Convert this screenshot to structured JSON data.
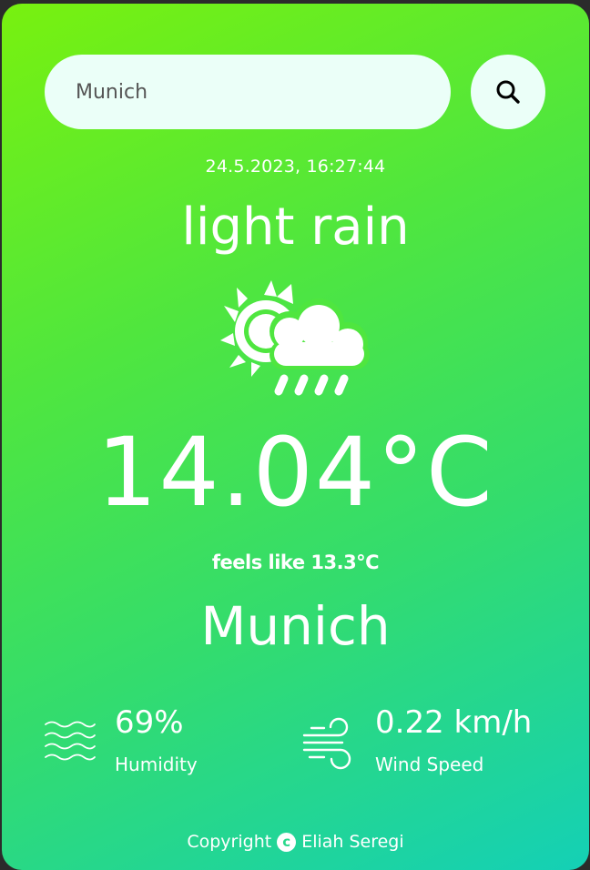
{
  "search": {
    "value": "Munich",
    "placeholder": ""
  },
  "icons": {
    "search": "search-icon",
    "weather": "partly-cloudy-rain-icon",
    "humidity": "humidity-waves-icon",
    "wind": "wind-icon",
    "copyright": "copyright-icon"
  },
  "weather": {
    "datetime": "24.5.2023, 16:27:44",
    "description": "light rain",
    "temperature": "14.04°C",
    "feels_like": "feels like 13.3°C",
    "city": "Munich"
  },
  "stats": {
    "humidity": {
      "value": "69%",
      "label": "Humidity"
    },
    "wind": {
      "value": "0.22 km/h",
      "label": "Wind Speed"
    }
  },
  "footer": {
    "copyright_label": "Copyright",
    "copyright_symbol": "c",
    "author": "Eliah Seregi"
  },
  "colors": {
    "gradient_start": "#78f10f",
    "gradient_end": "#14d0b6",
    "input_background": "#ebfff8",
    "text": "#ffffff",
    "page_background": "#2b2b2b"
  }
}
